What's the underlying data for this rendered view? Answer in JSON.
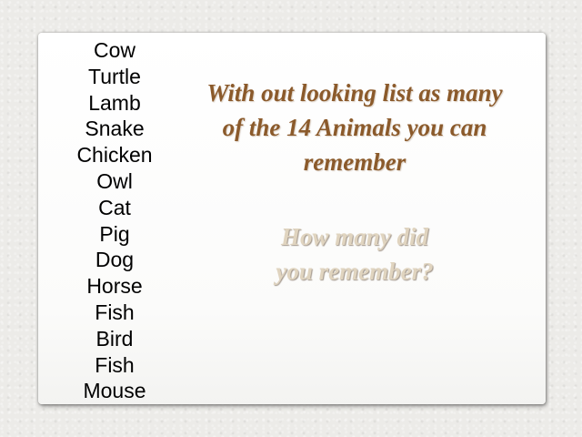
{
  "slide": {
    "animals": [
      "Cow",
      "Turtle",
      "Lamb",
      "Snake",
      "Chicken",
      "Owl",
      "Cat",
      "Pig",
      "Dog",
      "Horse",
      "Fish",
      "Bird",
      "Fish",
      "Mouse"
    ],
    "instruction_line1": "With out looking list as many",
    "instruction_line2": "of the 14 Animals you can",
    "instruction_line3": "remember",
    "question_line1": "How many did",
    "question_line2": "you remember?"
  },
  "colors": {
    "instruction_text": "#8b5a2b",
    "question_text": "#e0d4bf",
    "background": "#ecebe8",
    "card": "#ffffff"
  }
}
